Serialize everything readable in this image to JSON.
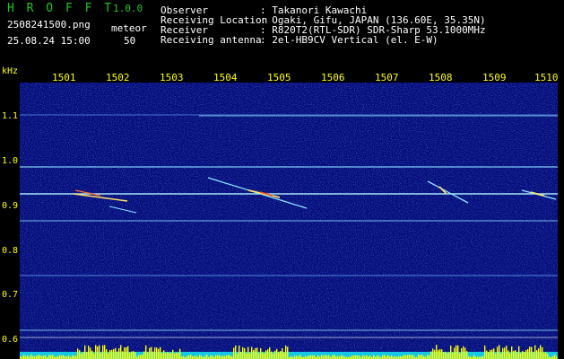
{
  "header": {
    "app_name": "H R O F F T",
    "version": "1.0.0",
    "filename": "2508241500.png",
    "mode_label": "meteor",
    "datetime": "25.08.24 15:00",
    "count": "50"
  },
  "info": {
    "labels": [
      "Observer",
      "Receiving Location",
      "Receiver",
      "Receiving antenna"
    ],
    "values": [
      ": Takanori Kawachi",
      ": Ogaki, Gifu, JAPAN (136.60E, 35.35N)",
      ": R820T2(RTL-SDR) SDR-Sharp 53.1000MHz",
      ": 2el-HB9CV Vertical (el. E-W)"
    ]
  },
  "axes": {
    "y_unit": "kHz",
    "y_ticks": [
      "1.1",
      "1.0",
      "0.9",
      "0.8",
      "0.7",
      "0.6"
    ],
    "x_ticks": [
      "1501",
      "1502",
      "1503",
      "1504",
      "1505",
      "1506",
      "1507",
      "1508",
      "1509",
      "1510"
    ]
  },
  "colors": {
    "header_green": "#1ec81e",
    "label_yellow": "#ffff00",
    "background_blue": "#050a78",
    "trace_cyan": "#8fe8ff"
  }
}
